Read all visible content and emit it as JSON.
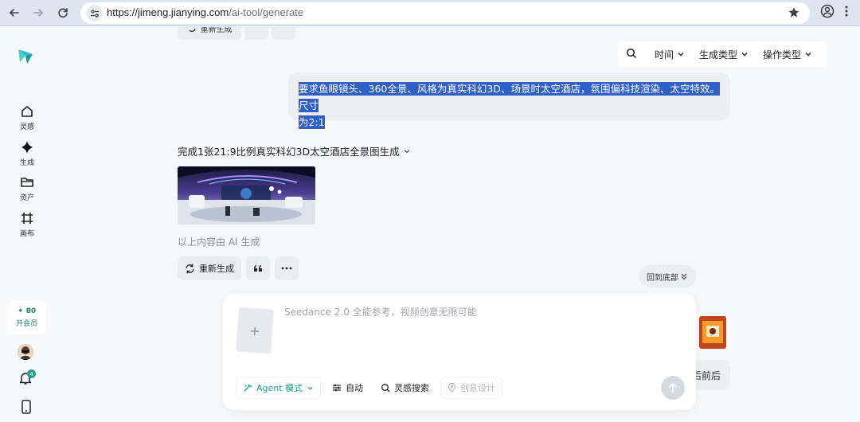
{
  "browser": {
    "url_host": "https://jimeng.jianying.com",
    "url_path": "/ai-tool/generate"
  },
  "sidebar": {
    "items": [
      {
        "label": "灵感",
        "icon": "home-icon"
      },
      {
        "label": "生成",
        "icon": "sparkle-icon"
      },
      {
        "label": "资产",
        "icon": "folder-icon"
      },
      {
        "label": "画布",
        "icon": "canvas-icon"
      }
    ],
    "credits": "✦ 80",
    "vip_label": "开会员",
    "notification_count": "4"
  },
  "top_actions": {
    "regenerate": "重新生成"
  },
  "filters": {
    "time": "时间",
    "gen_type": "生成类型",
    "op_type": "操作类型"
  },
  "prompt": {
    "text_line1": "要求鱼眼镜头、360全景、风格为真实科幻3D、场景时太空酒店，氛围偏科技渲染、太空特效。尺寸",
    "text_line2": "为2:1"
  },
  "result": {
    "title": "完成1张21:9比例真实科幻3D太空酒店全景图生成",
    "ai_note": "以上内容由 AI 生成",
    "regenerate": "重新生成"
  },
  "back_to_bottom": "回到底部",
  "partial_chip": "后前后",
  "composer": {
    "placeholder": "Seedance 2.0 全能参考，视频创意无限可能",
    "agent_mode": "Agent 模式",
    "auto": "自动",
    "inspiration_search": "灵感搜索",
    "creative_design": "创意设计"
  },
  "colors": {
    "accent": "#1a9c8b",
    "highlight": "#2f60c8"
  }
}
